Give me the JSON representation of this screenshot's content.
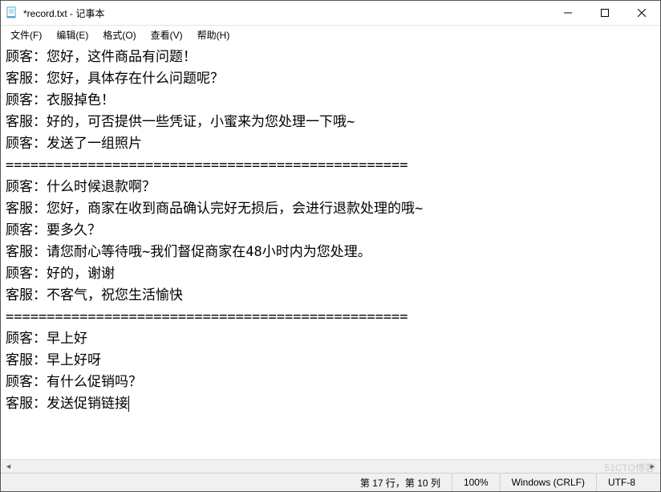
{
  "window": {
    "title": "*record.txt - 记事本"
  },
  "menu": {
    "file": "文件(F)",
    "edit": "编辑(E)",
    "format": "格式(O)",
    "view": "查看(V)",
    "help": "帮助(H)"
  },
  "content": {
    "lines": [
      "顾客：您好，这件商品有问题！",
      "客服：您好，具体存在什么问题呢？",
      "顾客：衣服掉色！",
      "客服：好的，可否提供一些凭证，小蜜来为您处理一下哦~",
      "顾客：发送了一组照片",
      "=================================================",
      "顾客：什么时候退款啊？",
      "客服：您好，商家在收到商品确认完好无损后，会进行退款处理的哦~",
      "顾客：要多久？",
      "客服：请您耐心等待哦~我们督促商家在48小时内为您处理。",
      "顾客：好的，谢谢",
      "客服：不客气，祝您生活愉快",
      "=================================================",
      "顾客：早上好",
      "客服：早上好呀",
      "顾客：有什么促销吗？",
      "客服：发送促销链接"
    ]
  },
  "status": {
    "position": "第 17 行，第 10 列",
    "zoom": "100%",
    "lineEnding": "Windows (CRLF)",
    "encoding": "UTF-8"
  },
  "watermark": "51CTO博客"
}
